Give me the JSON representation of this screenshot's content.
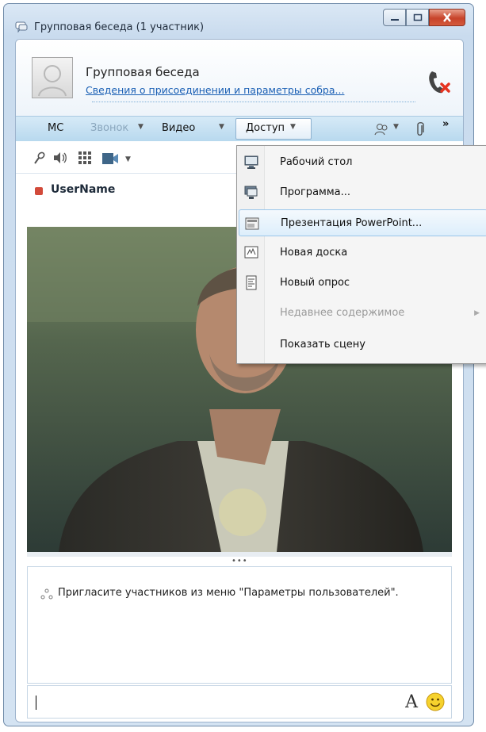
{
  "window": {
    "title": "Групповая беседа (1 участник)"
  },
  "header": {
    "conversation_title": "Групповая беседа",
    "join_info_link": "Сведения о присоединении и параметры собра..."
  },
  "toolbar": {
    "im_label": "МС",
    "call_label": "Звонок",
    "video_label": "Видео",
    "share_label": "Доступ",
    "more_label": "»"
  },
  "participant": {
    "name": "UserName",
    "status_color": "#d24a3a"
  },
  "chat": {
    "invite_message": "Пригласите участников из меню \"Параметры пользователей\".",
    "font_button": "A"
  },
  "share_menu": {
    "items": [
      {
        "label": "Рабочий стол",
        "icon": "desktop-icon",
        "enabled": true
      },
      {
        "label": "Программа...",
        "icon": "program-icon",
        "enabled": true
      },
      {
        "label": "Презентация PowerPoint...",
        "icon": "powerpoint-icon",
        "enabled": true,
        "highlighted": true
      },
      {
        "label": "Новая доска",
        "icon": "whiteboard-icon",
        "enabled": true
      },
      {
        "label": "Новый опрос",
        "icon": "poll-icon",
        "enabled": true
      },
      {
        "label": "Недавнее содержимое",
        "icon": "",
        "enabled": false
      },
      {
        "label": "Показать сцену",
        "icon": "",
        "enabled": true
      }
    ]
  },
  "colors": {
    "accent": "#1a5fb4",
    "close_button": "#c7432a"
  }
}
